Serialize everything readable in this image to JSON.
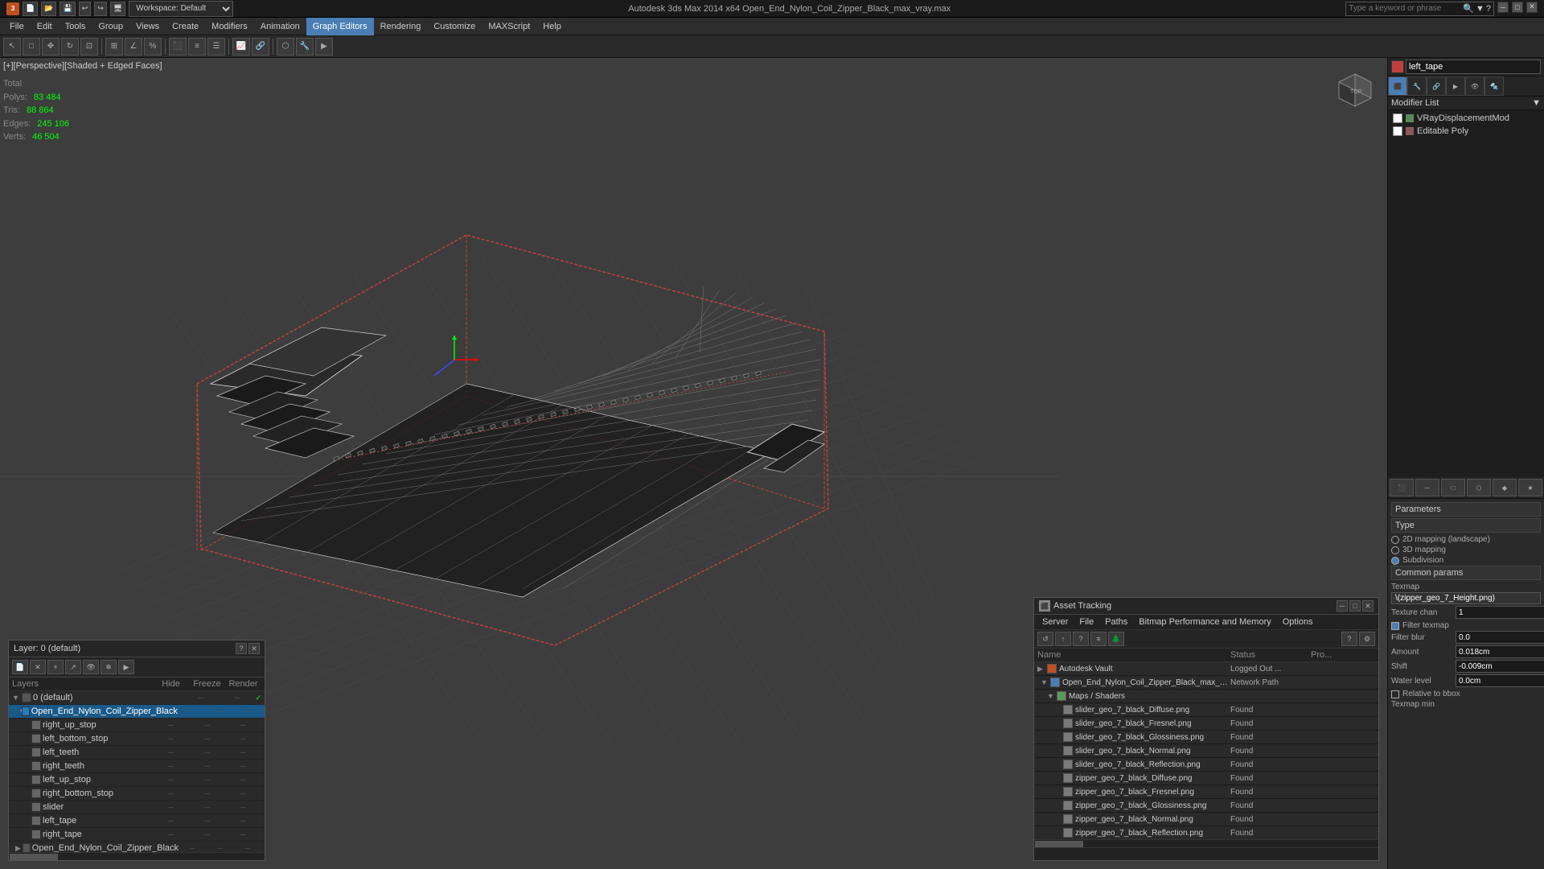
{
  "titleBar": {
    "appName": "3ds",
    "title": "Autodesk 3ds Max 2014 x64     Open_End_Nylon_Coil_Zipper_Black_max_vray.max",
    "searchPlaceholder": "Type a keyword or phrase",
    "minLabel": "─",
    "maxLabel": "□",
    "closeLabel": "✕"
  },
  "menuBar": {
    "items": [
      "File",
      "Edit",
      "Tools",
      "Group",
      "Views",
      "Create",
      "Modifiers",
      "Animation",
      "Graph Editors",
      "Rendering",
      "Animation",
      "Customize",
      "MAXScript",
      "Help"
    ]
  },
  "toolbar": {
    "workspaceLabel": "Workspace: Default"
  },
  "viewport": {
    "label": "[+][Perspective][Shaded + Edged Faces]",
    "stats": {
      "polys": {
        "label": "Polys:",
        "value": "83 484"
      },
      "tris": {
        "label": "Tris:",
        "value": "88 864"
      },
      "edges": {
        "label": "Edges:",
        "value": "245 106"
      },
      "verts": {
        "label": "Verts:",
        "value": "46 504"
      },
      "totalLabel": "Total"
    }
  },
  "rightPanel": {
    "objectName": "left_tape",
    "modifierListLabel": "Modifier List",
    "modifiers": [
      {
        "name": "VRayDisplacementMod",
        "checked": true
      },
      {
        "name": "Editable Poly",
        "checked": true
      }
    ],
    "parameters": {
      "sectionTitle": "Parameters",
      "typeSection": "Type",
      "types": [
        {
          "label": "2D mapping (landscape)",
          "checked": false
        },
        {
          "label": "3D mapping",
          "checked": false
        },
        {
          "label": "Subdivision",
          "checked": true
        }
      ],
      "commonParams": "Common params",
      "texmap": "Texmap",
      "texmapValue": "\\(zipper_geo_7_Height.png)",
      "textureChain": "Texture chan",
      "textureChainValue": "1",
      "filterTexmap": "Filter texmap",
      "filterTexmapChecked": true,
      "filterBlur": "Filter blur",
      "filterBlurValue": "0.0",
      "amount": "Amount",
      "amountValue": "0.018cm",
      "shift": "Shift",
      "shiftValue": "-0.009cm",
      "waterLevel": "Water level",
      "waterLevelValue": "0.0cm",
      "relativeToBox": "Relative to bbox",
      "texmapMin": "Texmap min"
    }
  },
  "layerPanel": {
    "title": "Layer: 0 (default)",
    "columns": {
      "layers": "Layers",
      "hide": "Hide",
      "freeze": "Freeze",
      "render": "Render"
    },
    "layers": [
      {
        "name": "0 (default)",
        "indent": 0,
        "active": true,
        "expanded": true
      },
      {
        "name": "Open_End_Nylon_Coil_Zipper_Black",
        "indent": 1,
        "selected": true
      },
      {
        "name": "right_up_stop",
        "indent": 2
      },
      {
        "name": "left_bottom_stop",
        "indent": 2
      },
      {
        "name": "left_teeth",
        "indent": 2
      },
      {
        "name": "right_teeth",
        "indent": 2
      },
      {
        "name": "left_up_stop",
        "indent": 2
      },
      {
        "name": "right_bottom_stop",
        "indent": 2
      },
      {
        "name": "slider",
        "indent": 2
      },
      {
        "name": "left_tape",
        "indent": 2
      },
      {
        "name": "right_tape",
        "indent": 2
      },
      {
        "name": "Open_End_Nylon_Coil_Zipper_Black",
        "indent": 1
      }
    ]
  },
  "assetPanel": {
    "title": "Asset Tracking",
    "menuItems": [
      "Server",
      "File",
      "Paths",
      "Bitmap Performance and Memory",
      "Options"
    ],
    "columns": {
      "name": "Name",
      "status": "Status",
      "path": "Pro..."
    },
    "items": [
      {
        "name": "Autodesk Vault",
        "indent": 0,
        "type": "vault",
        "status": "Logged Out ...",
        "path": ""
      },
      {
        "name": "Open_End_Nylon_Coil_Zipper_Black_max_vray.max",
        "indent": 1,
        "type": "file",
        "status": "Network Path",
        "path": ""
      },
      {
        "name": "Maps / Shaders",
        "indent": 2,
        "type": "map",
        "status": "",
        "path": ""
      },
      {
        "name": "slider_geo_7_black_Diffuse.png",
        "indent": 3,
        "type": "texture",
        "status": "Found",
        "path": ""
      },
      {
        "name": "slider_geo_7_black_Fresnel.png",
        "indent": 3,
        "type": "texture",
        "status": "Found",
        "path": ""
      },
      {
        "name": "slider_geo_7_black_Glossiness.png",
        "indent": 3,
        "type": "texture",
        "status": "Found",
        "path": ""
      },
      {
        "name": "slider_geo_7_black_Normal.png",
        "indent": 3,
        "type": "texture",
        "status": "Found",
        "path": ""
      },
      {
        "name": "slider_geo_7_black_Reflection.png",
        "indent": 3,
        "type": "texture",
        "status": "Found",
        "path": ""
      },
      {
        "name": "zipper_geo_7_black_Diffuse.png",
        "indent": 3,
        "type": "texture",
        "status": "Found",
        "path": ""
      },
      {
        "name": "zipper_geo_7_black_Fresnel.png",
        "indent": 3,
        "type": "texture",
        "status": "Found",
        "path": ""
      },
      {
        "name": "zipper_geo_7_black_Glossiness.png",
        "indent": 3,
        "type": "texture",
        "status": "Found",
        "path": ""
      },
      {
        "name": "zipper_geo_7_black_Normal.png",
        "indent": 3,
        "type": "texture",
        "status": "Found",
        "path": ""
      },
      {
        "name": "zipper_geo_7_black_Reflection.png",
        "indent": 3,
        "type": "texture",
        "status": "Found",
        "path": ""
      },
      {
        "name": "zipper_geo_7_Height.png",
        "indent": 3,
        "type": "texture",
        "status": "Found",
        "path": ""
      }
    ]
  },
  "icons": {
    "search": "🔍",
    "settings": "⚙",
    "help": "?",
    "expand": "▼",
    "collapse": "▶",
    "close": "✕",
    "minimize": "─",
    "maximize": "□",
    "folder": "📁",
    "file": "📄",
    "plus": "+",
    "minus": "─",
    "checkmark": "✓"
  }
}
